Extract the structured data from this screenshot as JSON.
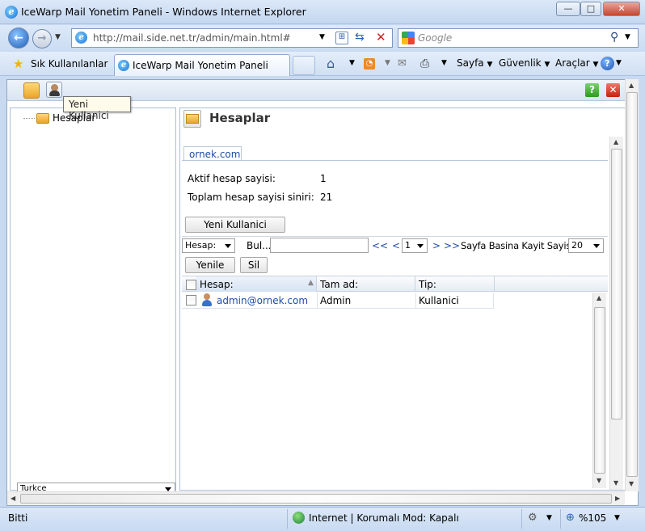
{
  "window": {
    "title": "IceWarp Mail Yonetim Paneli - Windows Internet Explorer"
  },
  "addressbar": {
    "url": "http://mail.side.net.tr/admin/main.html#"
  },
  "search": {
    "placeholder": "Google"
  },
  "favorites": {
    "label": "Sık Kullanılanlar"
  },
  "tab": {
    "title": "IceWarp Mail Yonetim Paneli"
  },
  "commandbar": {
    "sayfa": "Sayfa",
    "guvenlik": "Güvenlik",
    "araclar": "Araçlar"
  },
  "app": {
    "tooltip": "Yeni Kullanici",
    "tree": {
      "root": "Hesaplar"
    },
    "language": "Turkce",
    "heading": "Hesaplar",
    "domain_tab": "ornek.com",
    "stats": {
      "active_label": "Aktif hesap sayisi:",
      "active_value": "1",
      "limit_label": "Toplam hesap sayisi siniri:",
      "limit_value": "21"
    },
    "new_user_button": "Yeni Kullanici",
    "filter": {
      "field": "Hesap:",
      "find_label": "Bul...",
      "first": "<<",
      "prev": "<",
      "page": "1",
      "next": ">",
      "last": ">>",
      "per_page_label": "Sayfa Basina Kayit Sayisi:",
      "per_page_value": "20"
    },
    "buttons": {
      "refresh": "Yenile",
      "delete": "Sil"
    },
    "grid": {
      "columns": [
        "Hesap:",
        "Tam ad:",
        "Tip:"
      ],
      "rows": [
        {
          "account": "admin@ornek.com",
          "fullname": "Admin",
          "type": "Kullanici"
        }
      ]
    }
  },
  "status": {
    "left": "Bitti",
    "zone": "Internet | Korumalı Mod: Kapalı",
    "zoom": "%105"
  }
}
